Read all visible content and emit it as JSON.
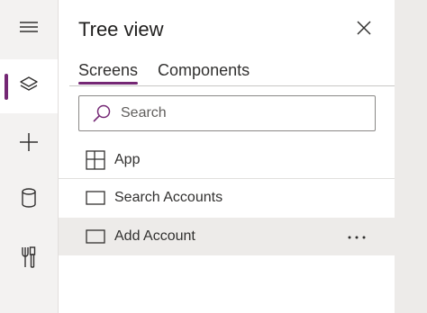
{
  "rail": {
    "items": [
      {
        "icon": "hamburger-menu-icon"
      },
      {
        "icon": "layers-icon",
        "active": true
      },
      {
        "icon": "plus-icon"
      },
      {
        "icon": "database-icon"
      },
      {
        "icon": "tools-icon"
      }
    ]
  },
  "panel": {
    "title": "Tree view",
    "tabs": [
      {
        "label": "Screens",
        "active": true
      },
      {
        "label": "Components"
      }
    ],
    "search": {
      "placeholder": "Search"
    },
    "items": [
      {
        "label": "App",
        "icon": "app-grid-icon"
      },
      {
        "label": "Search Accounts",
        "icon": "screen-icon"
      },
      {
        "label": "Add Account",
        "icon": "screen-icon",
        "selected": true
      }
    ]
  },
  "colors": {
    "accent": "#742774",
    "selected_row": "#edebe9",
    "rail_bg": "#f3f2f1"
  }
}
